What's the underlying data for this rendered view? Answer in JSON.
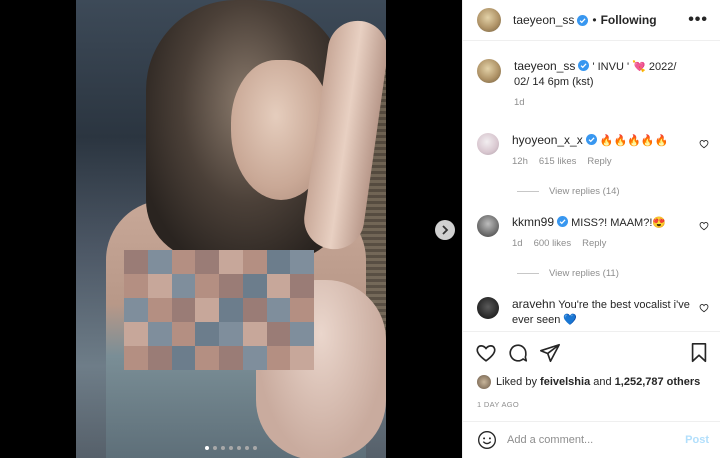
{
  "post": {
    "username": "taeyeon_ss",
    "follow_status": "Following",
    "separator": "•",
    "more_label": "•••",
    "caption_text": "' INVU ' 💘 2022/ 02/ 14 6pm (kst)",
    "caption_age": "1d",
    "carousel": {
      "current": 1,
      "total": 7
    },
    "next_label": "›"
  },
  "comments": [
    {
      "username": "hyoyeon_x_x",
      "verified": true,
      "text": "🔥🔥🔥🔥🔥",
      "age": "12h",
      "likes": "615 likes",
      "reply": "Reply",
      "view_replies": "View replies (14)"
    },
    {
      "username": "kkmn99",
      "verified": true,
      "text": "MISS?! MAAM?!😍",
      "age": "1d",
      "likes": "600 likes",
      "reply": "Reply",
      "view_replies": "View replies (11)"
    },
    {
      "username": "aravehn",
      "verified": false,
      "text": "You're the best vocalist i've ever seen 💙"
    }
  ],
  "likes_summary": {
    "prefix": "Liked by",
    "user": "feivelshia",
    "middle": "and",
    "count": "1,252,787 others"
  },
  "timestamp": "1 DAY AGO",
  "comment_box": {
    "placeholder": "Add a comment...",
    "post_label": "Post"
  },
  "icons": [
    "more-icon",
    "heart-icon",
    "comment-icon",
    "share-icon",
    "bookmark-icon",
    "emoji-icon",
    "verified-icon",
    "chevron-right-icon"
  ],
  "colors": {
    "verified": "#3897f0",
    "post_button": "#b2dffc",
    "secondary_text": "#8e8e8e"
  }
}
